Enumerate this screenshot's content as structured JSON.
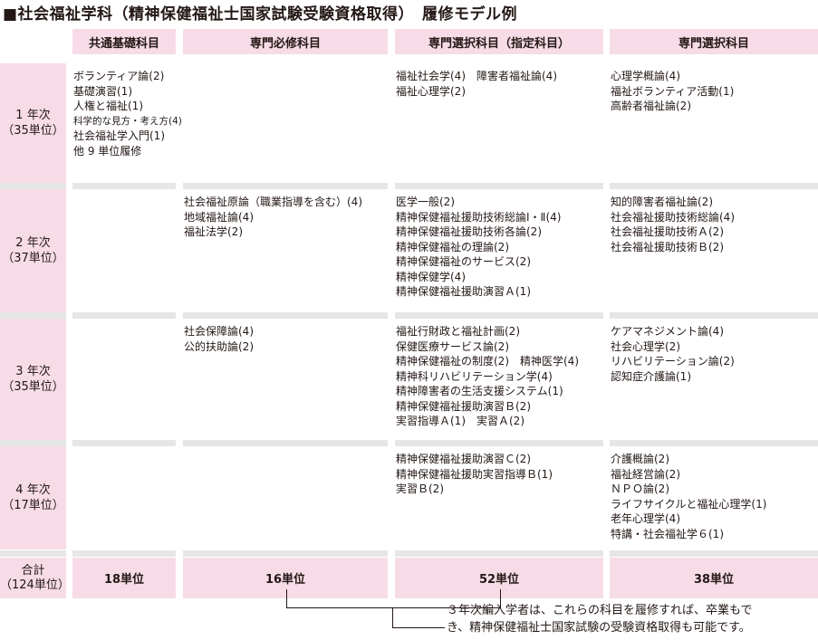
{
  "title": "■社会福祉学科（精神保健福祉士国家試験受験資格取得）　履修モデル例",
  "columns": [
    "共通基礎科目",
    "専門必修科目",
    "専門選択科目（指定科目）",
    "専門選択科目"
  ],
  "years": [
    {
      "label": "1 年次",
      "units": "（35単位）",
      "common": [
        "ボランティア論(2)",
        "基礎演習(1)",
        "人権と福祉(1)",
        "科学的な見方・考え方(4)",
        "社会福祉学入門(1)",
        "他 9 単位履修"
      ],
      "required": [],
      "designated": [
        "福祉社会学(4)　障害者福祉論(4)",
        "福祉心理学(2)"
      ],
      "elective": [
        "心理学概論(4)",
        "福祉ボランティア活動(1)",
        "高齢者福祉論(2)"
      ]
    },
    {
      "label": "2 年次",
      "units": "（37単位）",
      "common": [],
      "required": [
        "社会福祉原論（職業指導を含む）(4)",
        "地域福祉論(4)",
        "福祉法学(2)"
      ],
      "designated": [
        "医学一般(2)",
        "精神保健福祉援助技術総論Ⅰ・Ⅱ(4)",
        "精神保健福祉援助技術各論(2)",
        "精神保健福祉の理論(2)",
        "精神保健福祉のサービス(2)",
        "精神保健学(4)",
        "精神保健福祉援助演習Ａ(1)"
      ],
      "elective": [
        "知的障害者福祉論(2)",
        "社会福祉援助技術総論(4)",
        "社会福祉援助技術Ａ(2)",
        "社会福祉援助技術Ｂ(2)"
      ]
    },
    {
      "label": "3 年次",
      "units": "（35単位）",
      "common": [],
      "required": [
        "社会保障論(4)",
        "公的扶助論(2)"
      ],
      "designated": [
        "福祉行財政と福祉計画(2)",
        "保健医療サービス論(2)",
        "精神保健福祉の制度(2)　精神医学(4)",
        "精神科リハビリテーション学(4)",
        "精神障害者の生活支援システム(1)",
        "精神保健福祉援助演習Ｂ(2)",
        "実習指導Ａ(1)　実習Ａ(2)"
      ],
      "elective": [
        "ケアマネジメント論(4)",
        "社会心理学(2)",
        "リハビリテーション論(2)",
        "認知症介護論(1)"
      ]
    },
    {
      "label": "4 年次",
      "units": "（17単位）",
      "common": [],
      "required": [],
      "designated": [
        "精神保健福祉援助演習Ｃ(2)",
        "精神保健福祉援助実習指導Ｂ(1)",
        "実習Ｂ(2)"
      ],
      "elective": [
        "介護概論(2)",
        "福祉経営論(2)",
        "ＮＰＯ論(2)",
        "ライフサイクルと福祉心理学(1)",
        "老年心理学(4)",
        "特講・社会福祉学６(1)"
      ]
    }
  ],
  "total": {
    "label": "合計",
    "units": "（124単位）",
    "values": [
      "18単位",
      "16単位",
      "52単位",
      "38単位"
    ]
  },
  "note": [
    "３年次編入学者は、これらの科目を履修すれば、卒業もで",
    "き、精神保健福祉士国家試験の受験資格取得も可能です。"
  ],
  "colors": {
    "pink": "#f7dce8",
    "grey": "#e6e6e6",
    "text": "#231815"
  }
}
